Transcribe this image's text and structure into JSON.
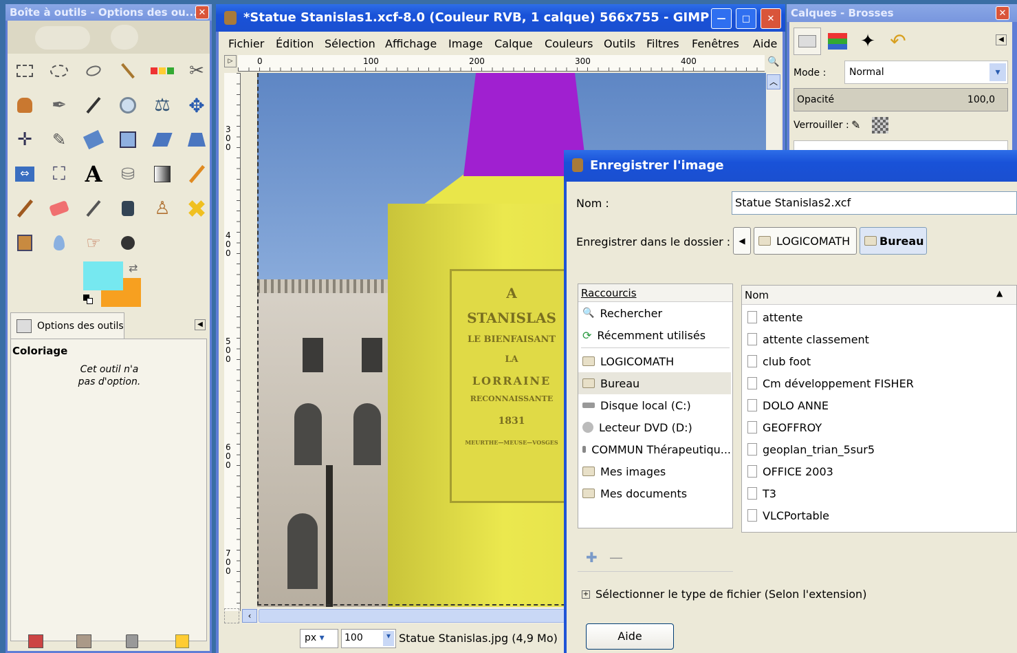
{
  "toolbox": {
    "title": "Boîte à outils - Options des ou...",
    "options_tab": "Options des outils",
    "tool_name": "Coloriage",
    "no_options_line1": "Cet outil n'a",
    "no_options_line2": "pas d'option.",
    "fg_color": "#76e8f0",
    "bg_color": "#f7a020"
  },
  "gimp": {
    "title": "*Statue Stanislas1.xcf-8.0 (Couleur RVB, 1 calque) 566x755 - GIMP",
    "menu": [
      "Fichier",
      "Édition",
      "Sélection",
      "Affichage",
      "Image",
      "Calque",
      "Couleurs",
      "Outils",
      "Filtres",
      "Fenêtres",
      "Aide"
    ],
    "ruler_h": [
      "0",
      "100",
      "200",
      "300",
      "400"
    ],
    "ruler_v": [
      "300",
      "400",
      "500",
      "600",
      "700"
    ],
    "unit": "px",
    "zoom": "100",
    "status": "Statue Stanislas.jpg (4,9 Mo)",
    "plaque": {
      "l1": "A",
      "l2": "STANISLAS",
      "l3": "LE BIENFAISANT",
      "l4": "LA",
      "l5": "LORRAINE",
      "l6": "RECONNAISSANTE",
      "l7": "1831",
      "l8": "MEURTHE—MEUSE—VOSGES"
    }
  },
  "layers": {
    "title": "Calques - Brosses",
    "mode_label": "Mode :",
    "mode_value": "Normal",
    "opacity_label": "Opacité",
    "opacity_value": "100,0",
    "lock_label": "Verrouiller :"
  },
  "dialog": {
    "title": "Enregistrer l'image",
    "name_label": "Nom :",
    "name_value": "Statue Stanislas2.xcf",
    "folder_label": "Enregistrer dans le dossier :",
    "crumb1": "LOGICOMATH",
    "crumb2": "Bureau",
    "shortcuts_header": "Raccourcis",
    "shortcuts": [
      "Rechercher",
      "Récemment utilisés",
      "LOGICOMATH",
      "Bureau",
      "Disque local (C:)",
      "Lecteur DVD (D:)",
      "COMMUN Thérapeutiqu...",
      "Mes images",
      "Mes documents"
    ],
    "files_header": "Nom",
    "files": [
      "attente",
      "attente classement",
      "club foot",
      "Cm développement FISHER",
      "DOLO ANNE",
      "GEOFFROY",
      "geoplan_trian_5sur5",
      "OFFICE 2003",
      "T3",
      "VLCPortable"
    ],
    "file_type_label": "Sélectionner le type de fichier (Selon l'extension)",
    "help_button": "Aide"
  }
}
